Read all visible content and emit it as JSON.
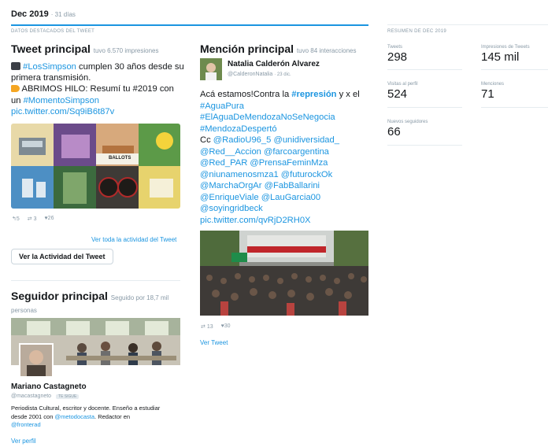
{
  "header": {
    "month": "Dec 2019",
    "days": "· 31 días"
  },
  "highlights": {
    "label": "DATOS DESTACADOS DEL TWEET"
  },
  "top_tweet": {
    "title": "Tweet principal",
    "subtitle": "tuvo 6.570 impresiones",
    "line1_hashtag": "#LosSimpson",
    "line1_rest": "cumplen 30 años desde su primera transmisión.",
    "line2_pre": "ABRIMOS HILO: Resumí tu #2019 con un",
    "line2_hashtag": "#MomentoSimpson",
    "link": "pic.twitter.com/Sq9iB6t87v",
    "replies": "5",
    "retweets": "3",
    "likes": "26",
    "view_all": "Ver toda la actividad del Tweet",
    "button": "Ver la Actividad del Tweet",
    "image_text": "BALLOTS"
  },
  "top_follower": {
    "title": "Seguidor principal",
    "subtitle": "Seguido por 18,7 mil",
    "subtitle2": "personas",
    "name": "Mariano Castagneto",
    "handle": "@macastagneto",
    "follows_badge": "TE SIGUE",
    "bio_line1": "Periodista Cultural, escritor y docente. Enseño a estudiar",
    "bio_pre": "desde 2001 con",
    "bio_mention": "@metodocasta",
    "bio_post": ". Redactor en",
    "bio_mention2": "@fronterad",
    "link": "Ver perfil"
  },
  "top_mention": {
    "title": "Mención principal",
    "subtitle": "tuvo 84 interacciones",
    "user_name": "Natalia Calderón Alvarez",
    "user_handle": "@CalderonNatalia",
    "date": "· 23 dic.",
    "line1_pre": "Acá estamos!Contra la",
    "line1_hashtag": "#represión",
    "line1_post": "y x el",
    "lines_blue": [
      "#AguaPura",
      "#ElAguaDeMendozaNoSeNegocia",
      "#MendozaDespertó"
    ],
    "cc_pre": "Cc",
    "cc_mentions": [
      "@RadioU96_5 @unidiversidad_",
      "@Red__Accion @farcoargentina",
      "@Red_PAR @PrensaFeminMza",
      "@niunamenosmza1 @futurockOk",
      "@MarchaOrgAr @FabBallarini",
      "@EnriqueViale @LauGarcia00",
      "@soyingridbeck"
    ],
    "link": "pic.twitter.com/qvRjD2RH0X",
    "retweets": "13",
    "likes": "30",
    "view": "Ver Tweet"
  },
  "summary": {
    "label": "RESUMEN DE DEC 2019",
    "tweets_label": "Tweets",
    "tweets_value": "298",
    "impressions_label": "Impresiones de Tweets",
    "impressions_value": "145 mil",
    "visits_label": "Visitas al perfil",
    "visits_value": "524",
    "mentions_label": "Menciones",
    "mentions_value": "71",
    "followers_label": "Nuevos seguidores",
    "followers_value": "66"
  },
  "colors": {
    "accent": "#1b95e0",
    "text": "#14171a",
    "muted": "#8899a6"
  }
}
